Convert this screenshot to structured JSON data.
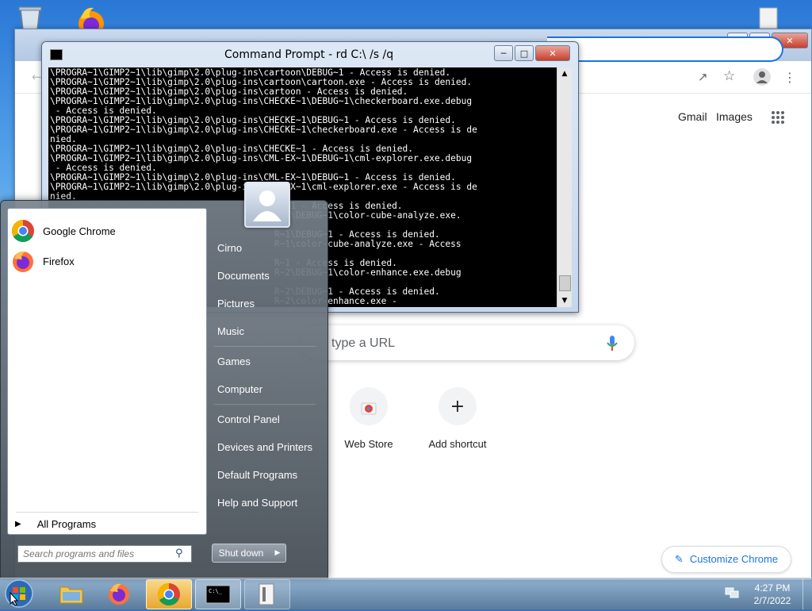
{
  "colors": {
    "chrome_accent": "#1a73e8",
    "console_bg": "#000000",
    "console_text": "#ffffff",
    "start_menu_bg": "#5c6670",
    "taskbar_bg": "#6f8fae"
  },
  "icons": {
    "recycle_bin": "recycle-bin-icon",
    "firefox": "firefox-icon",
    "chrome": "chrome-icon",
    "explorer": "folder-icon",
    "cmd": "command-prompt-icon",
    "user": "user-icon"
  },
  "chrome": {
    "header_links": {
      "gmail": "Gmail",
      "images": "Images"
    },
    "search_placeholder": "type a URL",
    "shortcuts": [
      {
        "label": "Web Store"
      },
      {
        "label": "Add shortcut"
      }
    ],
    "customize_label": "Customize Chrome"
  },
  "cmd": {
    "title": "Command Prompt - rd  C:\\ /s /q",
    "lines": [
      "\\PROGRA~1\\GIMP2~1\\lib\\gimp\\2.0\\plug-ins\\cartoon\\DEBUG~1 - Access is denied.",
      "\\PROGRA~1\\GIMP2~1\\lib\\gimp\\2.0\\plug-ins\\cartoon\\cartoon.exe - Access is denied.",
      "\\PROGRA~1\\GIMP2~1\\lib\\gimp\\2.0\\plug-ins\\cartoon - Access is denied.",
      "\\PROGRA~1\\GIMP2~1\\lib\\gimp\\2.0\\plug-ins\\CHECKE~1\\DEBUG~1\\checkerboard.exe.debug",
      " - Access is denied.",
      "\\PROGRA~1\\GIMP2~1\\lib\\gimp\\2.0\\plug-ins\\CHECKE~1\\DEBUG~1 - Access is denied.",
      "\\PROGRA~1\\GIMP2~1\\lib\\gimp\\2.0\\plug-ins\\CHECKE~1\\checkerboard.exe - Access is de",
      "nied.",
      "\\PROGRA~1\\GIMP2~1\\lib\\gimp\\2.0\\plug-ins\\CHECKE~1 - Access is denied.",
      "\\PROGRA~1\\GIMP2~1\\lib\\gimp\\2.0\\plug-ins\\CML-EX~1\\DEBUG~1\\cml-explorer.exe.debug",
      " - Access is denied.",
      "\\PROGRA~1\\GIMP2~1\\lib\\gimp\\2.0\\plug-ins\\CML-EX~1\\DEBUG~1 - Access is denied.",
      "\\PROGRA~1\\GIMP2~1\\lib\\gimp\\2.0\\plug-ins\\CML-EX~1\\cml-explorer.exe - Access is de",
      "nied.",
      "                                          EX~1 - Access is denied.",
      "                                          R~1\\DEBUG~1\\color-cube-analyze.exe.",
      "",
      "                                          R~1\\DEBUG~1 - Access is denied.",
      "                                          R~1\\color-cube-analyze.exe - Access",
      "",
      "                                          R~1 - Access is denied.",
      "                                          R~2\\DEBUG~1\\color-enhance.exe.debug",
      "",
      "                                          R~2\\DEBUG~1 - Access is denied.",
      "                                          R~2\\color-enhance.exe -"
    ]
  },
  "start_menu": {
    "pinned": [
      {
        "label": "Google Chrome",
        "icon": "chrome-icon"
      },
      {
        "label": "Firefox",
        "icon": "firefox-icon"
      }
    ],
    "all_programs": "All Programs",
    "search_placeholder": "Search programs and files",
    "right_items": [
      "Cirno",
      "Documents",
      "Pictures",
      "Music",
      "Games",
      "Computer",
      "Control Panel",
      "Devices and Printers",
      "Default Programs",
      "Help and Support"
    ],
    "shutdown_label": "Shut down"
  },
  "taskbar": {
    "time": "4:27 PM",
    "date": "2/7/2022"
  }
}
